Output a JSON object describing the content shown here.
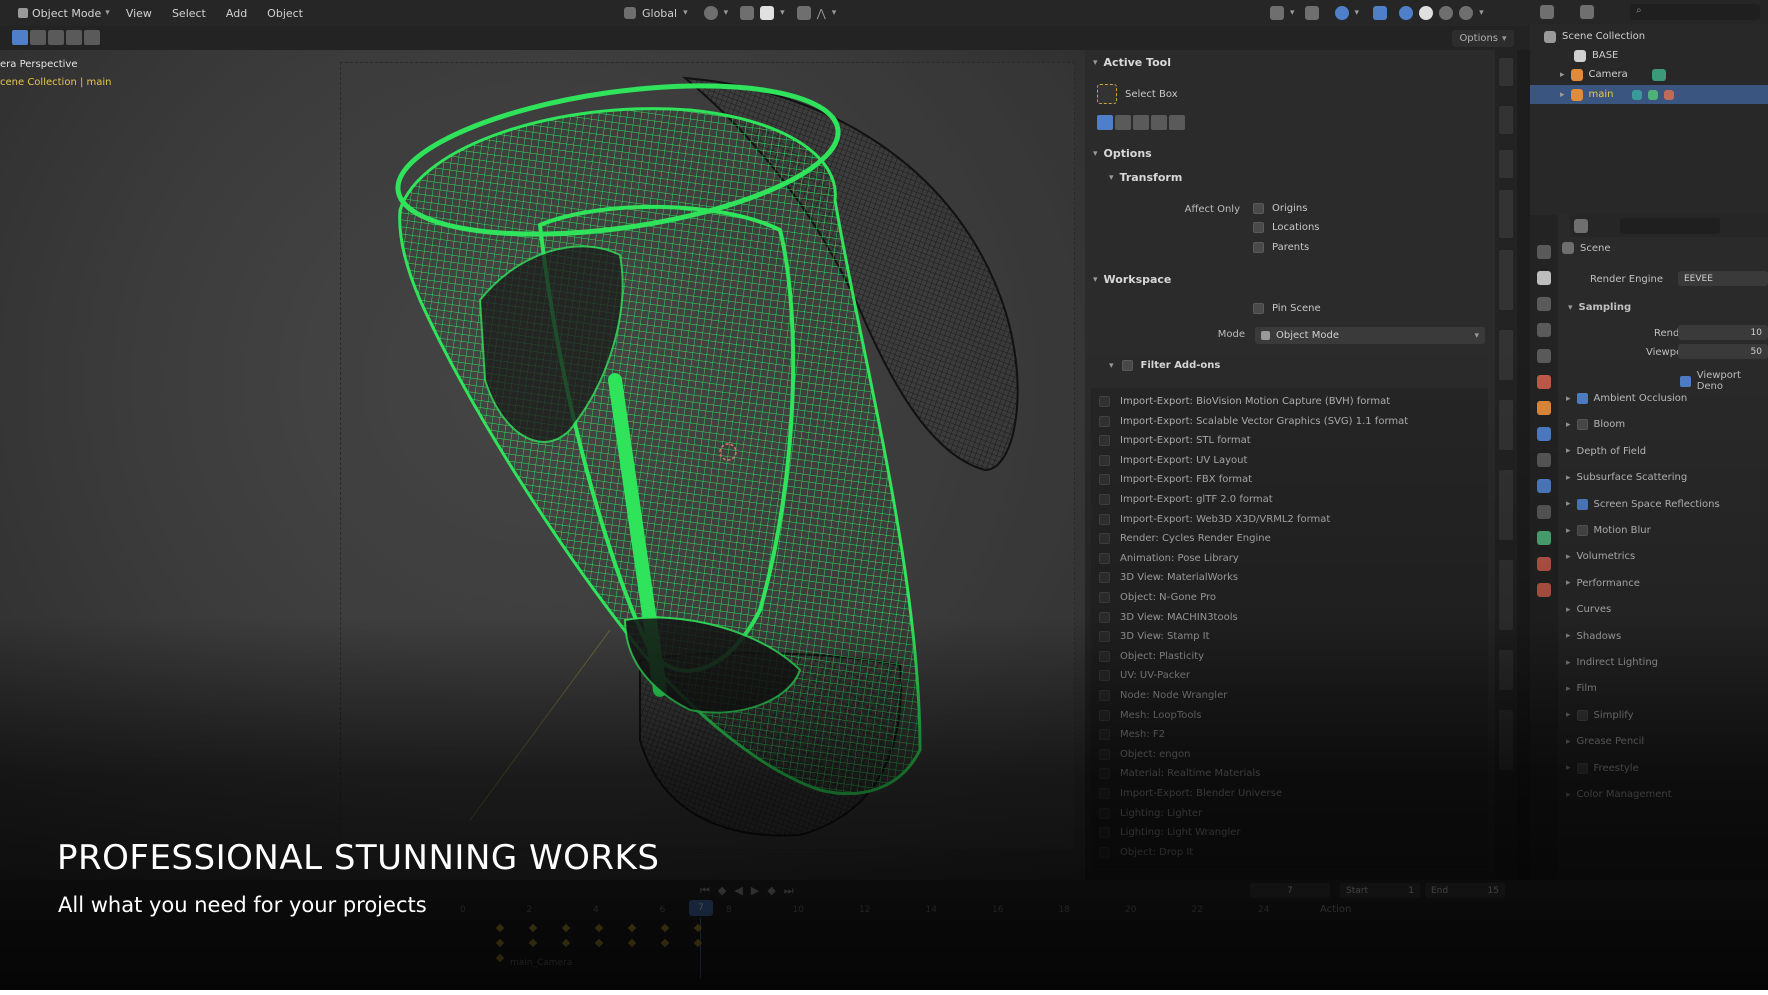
{
  "header": {
    "mode_label": "Object Mode",
    "menus": [
      "View",
      "Select",
      "Add",
      "Object"
    ],
    "transform_orientation": "Global",
    "options_label": "Options"
  },
  "viewport": {
    "title": "era Perspective",
    "collection_path": "cene Collection | main"
  },
  "n_panel": {
    "active_tool_header": "Active Tool",
    "tool_name": "Select Box",
    "options_header": "Options",
    "transform_header": "Transform",
    "affect_only_label": "Affect Only",
    "affect_only_items": [
      "Origins",
      "Locations",
      "Parents"
    ],
    "workspace_header": "Workspace",
    "pin_scene_label": "Pin Scene",
    "mode_label": "Mode",
    "mode_value": "Object Mode",
    "filter_addons_label": "Filter Add-ons",
    "addons": [
      "Import-Export: BioVision Motion Capture (BVH) format",
      "Import-Export: Scalable Vector Graphics (SVG) 1.1 format",
      "Import-Export: STL format",
      "Import-Export: UV Layout",
      "Import-Export: FBX format",
      "Import-Export: glTF 2.0 format",
      "Import-Export: Web3D X3D/VRML2 format",
      "Render: Cycles Render Engine",
      "Animation: Pose Library",
      "3D View: MaterialWorks",
      "Object: N-Gone Pro",
      "3D View: MACHIN3tools",
      "3D View: Stamp It",
      "Object: Plasticity",
      "UV: UV-Packer",
      "Node: Node Wrangler",
      "Mesh: LoopTools",
      "Mesh: F2",
      "Object: engon",
      "Material: Realtime Materials",
      "Import-Export: Blender Universe",
      "Lighting: Lighter",
      "Lighting: Light Wrangler",
      "Object: Drop It"
    ]
  },
  "outliner": {
    "root": "Scene Collection",
    "items": [
      "BASE",
      "Camera",
      "main"
    ]
  },
  "properties": {
    "scene_label": "Scene",
    "render_engine_label": "Render Engine",
    "render_engine_value": "EEVEE",
    "sampling_header": "Sampling",
    "render_label": "Render",
    "render_value": "10",
    "viewport_label": "Viewport",
    "viewport_value": "50",
    "viewport_denoise_label": "Viewport Deno",
    "panels": [
      "Ambient Occlusion",
      "Bloom",
      "Depth of Field",
      "Subsurface Scattering",
      "Screen Space Reflections",
      "Motion Blur",
      "Volumetrics",
      "Performance",
      "Curves",
      "Shadows",
      "Indirect Lighting",
      "Film",
      "Simplify",
      "Grease Pencil",
      "Freestyle",
      "Color Management"
    ]
  },
  "timeline": {
    "current_frame": "7",
    "start_label": "Start",
    "start_value": "1",
    "end_label": "End",
    "end_value": "15",
    "ruler_numbers": [
      "0",
      "2",
      "4",
      "6",
      "8",
      "10",
      "12",
      "14",
      "16",
      "18",
      "20",
      "22",
      "24"
    ],
    "action_label": "Action",
    "track_label": "main_Camera"
  },
  "promo": {
    "title": "PROFESSIONAL STUNNING WORKS",
    "subtitle": "All what you need for your projects"
  },
  "colors": {
    "wire_green": "#2fe35a",
    "wire_dark": "#1a1a1a",
    "accent_blue": "#4f7fc8",
    "collection_yellow": "#e8c84a"
  }
}
